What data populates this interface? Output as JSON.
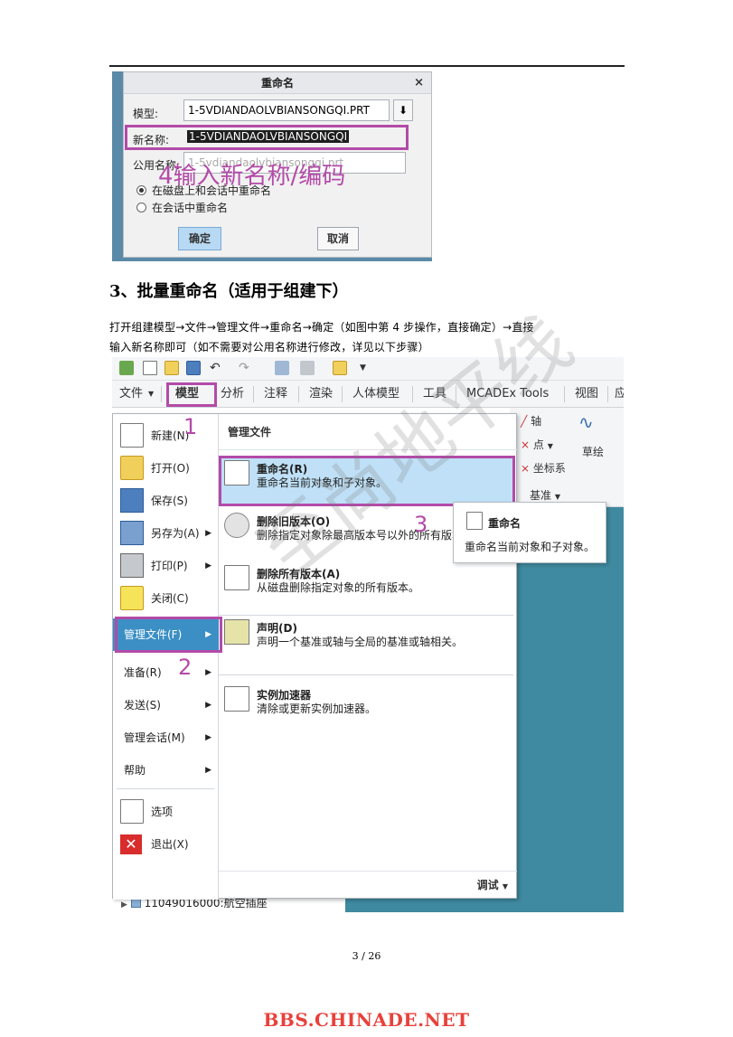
{
  "dialog": {
    "title": "重命名",
    "close": "×",
    "model_label": "模型:",
    "model_value": "1-5VDIANDAOLVBIANSONGQI.PRT",
    "new_name_label": "新名称:",
    "new_name_value": "1-5VDIANDAOLVBIANSONGQI",
    "common_name_label": "公用名称:",
    "common_name_value": "1-5vdiandaolvbiansongqi.prt",
    "radio1": "在磁盘上和会话中重命名",
    "radio2": "在会话中重命名",
    "ok": "确定",
    "cancel": "取消",
    "annotation": "4输入新名称/编码"
  },
  "heading": "3、批量重命名（适用于组建下）",
  "para": {
    "line1": "打开组建模型→文件→管理文件→重命名→确定（如图中第 4 步操作，直接确定）→直接",
    "line2": "输入新名称即可（如不需要对公用名称进行修改，详见以下步骤）"
  },
  "ribbon": {
    "tabs": [
      "文件",
      "模型",
      "分析",
      "注释",
      "渲染",
      "人体模型",
      "工具",
      "MCADEx Tools",
      "视图",
      "应"
    ],
    "axis": "轴",
    "point": "点",
    "csys": "坐标系",
    "sketch": "草绘",
    "datum": "基准"
  },
  "menu": {
    "left": [
      {
        "label": "新建(N)"
      },
      {
        "label": "打开(O)"
      },
      {
        "label": "保存(S)"
      },
      {
        "label": "另存为(A)"
      },
      {
        "label": "打印(P)"
      },
      {
        "label": "关闭(C)"
      },
      {
        "label": "管理文件(F)"
      },
      {
        "label": "准备(R)"
      },
      {
        "label": "发送(S)"
      },
      {
        "label": "管理会话(M)"
      },
      {
        "label": "帮助"
      },
      {
        "label": "选项"
      },
      {
        "label": "退出(X)"
      }
    ],
    "right_header": "管理文件",
    "right": [
      {
        "title": "重命名(R)",
        "desc": "重命名当前对象和子对象。"
      },
      {
        "title": "删除旧版本(O)",
        "desc": "删除指定对象除最高版本号以外的所有版本。"
      },
      {
        "title": "删除所有版本(A)",
        "desc": "从磁盘删除指定对象的所有版本。"
      },
      {
        "title": "声明(D)",
        "desc": "声明一个基准或轴与全局的基准或轴相关。"
      },
      {
        "title": "实例加速器",
        "desc": "清除或更新实例加速器。"
      }
    ],
    "footer": "调试",
    "step1": "1",
    "step2": "2",
    "step3": "3"
  },
  "tooltip": {
    "title": "重命名",
    "desc": "重命名当前对象和子对象。"
  },
  "tree_item": "11049016000:航空插座",
  "watermark": "至尚地平线",
  "page_number": "3 / 26",
  "site": "BBS.CHINADE.NET",
  "colors": {
    "annotation": "#b34ba8",
    "site": "#e8413b",
    "selected": "#bfe0f6",
    "active": "#3b8fc4",
    "teal": "#3f8aa0"
  }
}
